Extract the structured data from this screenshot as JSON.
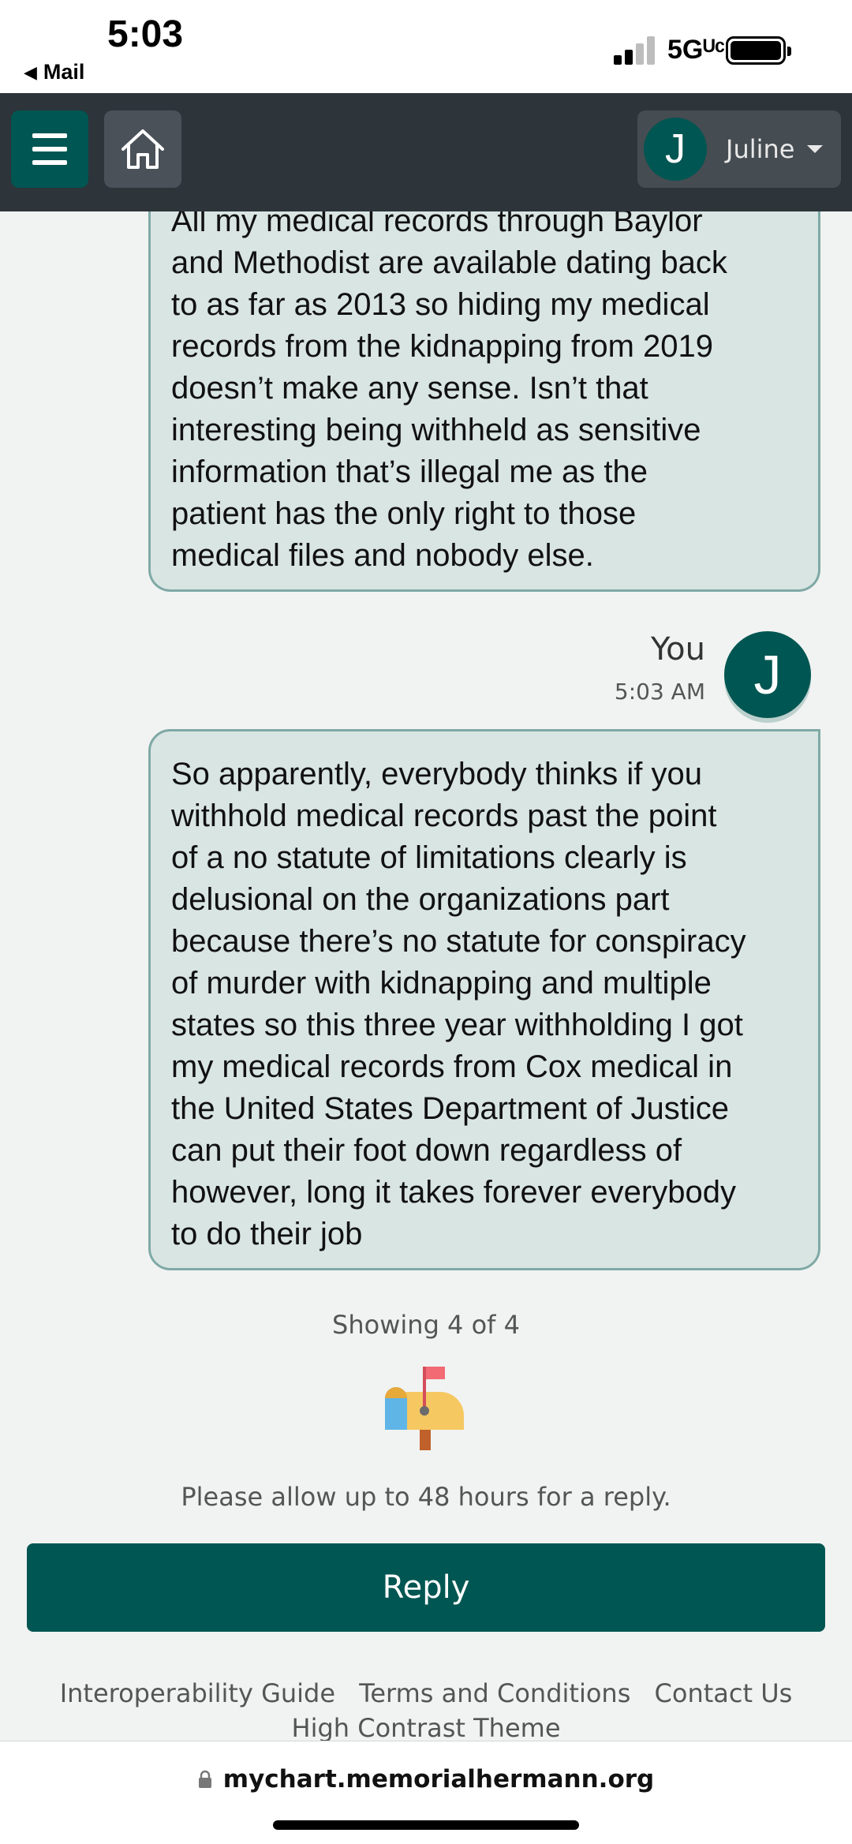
{
  "status_bar": {
    "time": "5:03",
    "back_label": "Mail",
    "network": "5Gᵁᶜ"
  },
  "header": {
    "user_initial": "J",
    "user_name": "Juline"
  },
  "messages": [
    {
      "text": "All my medical records through Baylor\nand Methodist are available dating back\nto as far as 2013 so hiding my medical\nrecords from the kidnapping from 2019\ndoesn’t make any sense. Isn’t that\ninteresting being withheld as sensitive\ninformation that’s illegal me as the\npatient has the only right to those\nmedical files and nobody else."
    },
    {
      "sender": "You",
      "time": "5:03 AM",
      "avatar_initial": "J",
      "text": "So apparently, everybody thinks if you\nwithhold medical records past the point\nof a no statute of limitations clearly is\ndelusional on the organizations part\nbecause there’s no statute for conspiracy\nof murder with kidnapping and multiple\nstates so this three year withholding I got\nmy medical records from Cox medical in\nthe United States Department of Justice\ncan put their foot down regardless of\nhowever, long it takes forever everybody\nto do their job"
    }
  ],
  "showing_text": "Showing 4 of 4",
  "mailbox_icon": "mailbox-icon",
  "reply_note": "Please allow up to 48 hours for a reply.",
  "reply_button": "Reply",
  "footer": {
    "links": [
      "Interoperability Guide",
      "Terms and Conditions",
      "Contact Us"
    ],
    "high_contrast": "High Contrast Theme"
  },
  "browser": {
    "url": "mychart.memorialhermann.org"
  },
  "colors": {
    "brand_teal": "#005652",
    "header_bg": "#2d343a",
    "bubble_bg": "#d9e5e3"
  }
}
